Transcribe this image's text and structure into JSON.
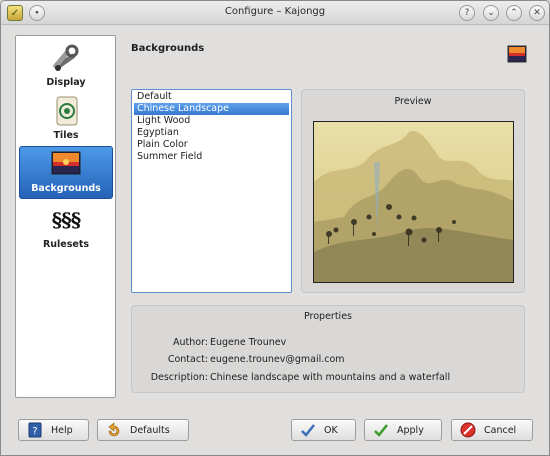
{
  "window": {
    "title": "Configure – Kajongg",
    "help_glyph": "?",
    "min_glyph": "⌄",
    "max_glyph": "⌃",
    "close_glyph": "✕",
    "menu_glyph": "∙"
  },
  "sidebar": {
    "items": [
      {
        "label": "Display",
        "icon": "display-tools-icon"
      },
      {
        "label": "Tiles",
        "icon": "mahjong-tile-icon"
      },
      {
        "label": "Backgrounds",
        "icon": "landscape-picture-icon",
        "selected": true
      },
      {
        "label": "Rulesets",
        "icon": "section-sign-icon",
        "glyph": "§§§"
      }
    ]
  },
  "page": {
    "heading": "Backgrounds"
  },
  "backgrounds": {
    "items": [
      "Default",
      "Chinese Landscape",
      "Light Wood",
      "Egyptian",
      "Plain Color",
      "Summer Field"
    ],
    "selected": "Chinese Landscape"
  },
  "preview": {
    "caption": "Preview"
  },
  "properties": {
    "caption": "Properties",
    "author_label": "Author:",
    "author": "Eugene Trounev",
    "contact_label": "Contact:",
    "contact": "eugene.trounev@gmail.com",
    "description_label": "Description:",
    "description": "Chinese landscape with mountains and a waterfall"
  },
  "buttons": {
    "help": "Help",
    "defaults": "Defaults",
    "ok": "OK",
    "apply": "Apply",
    "cancel": "Cancel"
  },
  "colors": {
    "selection": "#3578cf",
    "window_bg": "#e0dfde"
  }
}
